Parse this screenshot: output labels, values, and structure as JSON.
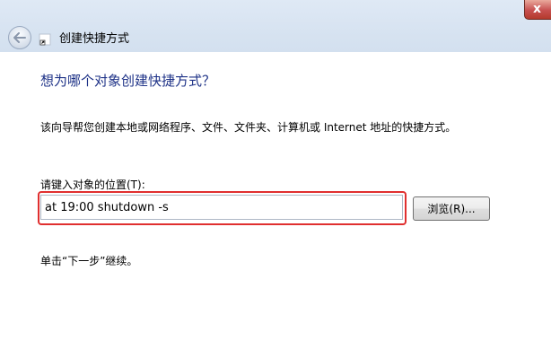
{
  "window": {
    "title": "创建快捷方式",
    "close_glyph": "x",
    "icons": {
      "back": "back-arrow-icon",
      "wizard": "shortcut-wizard-icon"
    }
  },
  "page": {
    "heading": "想为哪个对象创建快捷方式？",
    "description": "该向导帮您创建本地或网络程序、文件、文件夹、计算机或 Internet 地址的快捷方式。",
    "location_label": "请键入对象的位置(T):",
    "location_value": "at 19:00 shutdown -s",
    "browse_label": "浏览(R)...",
    "next_hint": "单击“下一步”继续。"
  },
  "colors": {
    "heading": "#1e3287",
    "highlight": "#e02f2f"
  }
}
